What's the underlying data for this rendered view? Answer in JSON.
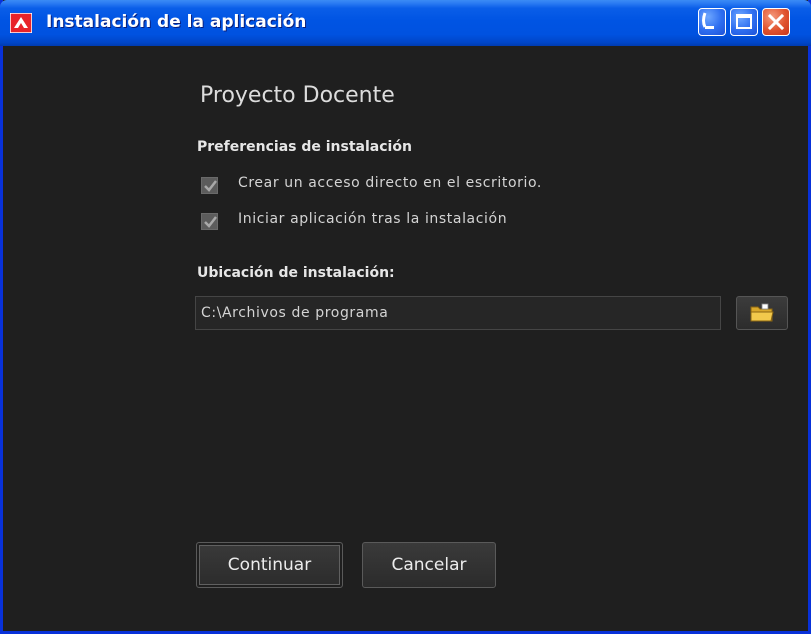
{
  "window": {
    "title": "Instalación de la aplicación",
    "controls": {
      "minimize": "minimize-icon",
      "maximize": "maximize-icon",
      "close": "close-icon"
    }
  },
  "app": {
    "name": "Proyecto Docente"
  },
  "preferences": {
    "heading": "Preferencias de instalación",
    "options": [
      {
        "label": "Crear un acceso directo en el escritorio.",
        "checked": true
      },
      {
        "label": "Iniciar aplicación tras la instalación",
        "checked": true
      }
    ]
  },
  "location": {
    "heading": "Ubicación de instalación:",
    "path": "C:\\Archivos de programa",
    "browse_icon": "folder-icon"
  },
  "actions": {
    "continue_label": "Continuar",
    "cancel_label": "Cancelar"
  },
  "colors": {
    "titlebar": "#0054e3",
    "background": "#1f1f1f",
    "close_button": "#e0532f"
  }
}
